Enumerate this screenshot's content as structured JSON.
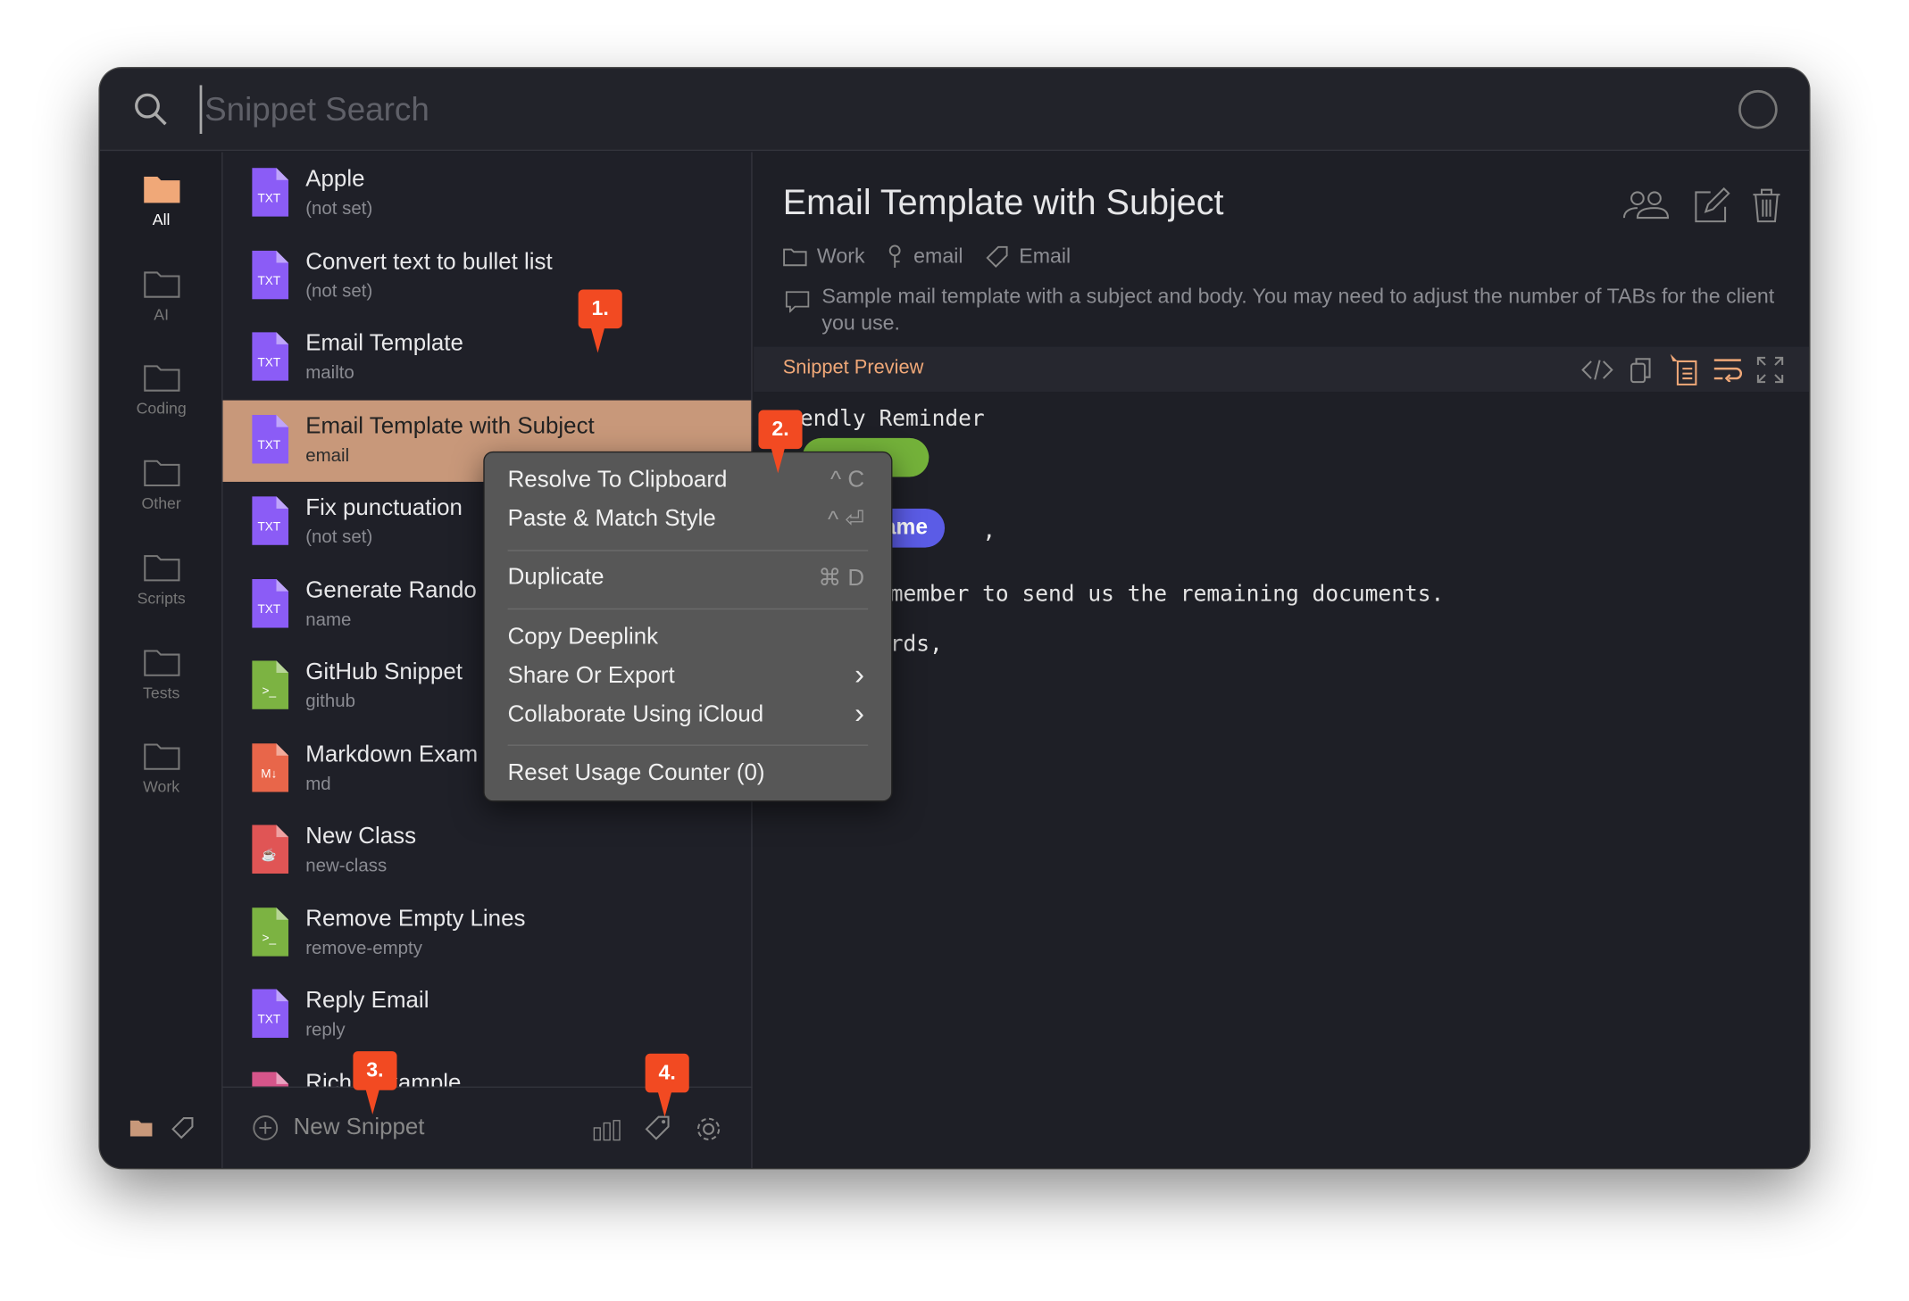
{
  "search": {
    "placeholder": "Snippet Search"
  },
  "sidebar": {
    "folders": [
      {
        "label": "All",
        "active": true
      },
      {
        "label": "AI"
      },
      {
        "label": "Coding"
      },
      {
        "label": "Other"
      },
      {
        "label": "Scripts"
      },
      {
        "label": "Tests"
      },
      {
        "label": "Work"
      }
    ]
  },
  "snippets": [
    {
      "title": "Apple",
      "subtitle": "(not set)",
      "type": "txt"
    },
    {
      "title": "Convert text to bullet list",
      "subtitle": "(not set)",
      "type": "txt"
    },
    {
      "title": "Email Template",
      "subtitle": "mailto",
      "type": "txt"
    },
    {
      "title": "Email Template with Subject",
      "subtitle": "email",
      "type": "txt",
      "selected": true
    },
    {
      "title": "Fix punctuation",
      "subtitle": "(not set)",
      "type": "txt"
    },
    {
      "title": "Generate Rando",
      "subtitle": "name",
      "type": "txt"
    },
    {
      "title": "GitHub Snippet",
      "subtitle": "github",
      "type": "shell"
    },
    {
      "title": "Markdown Exam",
      "subtitle": "md",
      "type": "md"
    },
    {
      "title": "New Class",
      "subtitle": "new-class",
      "type": "java"
    },
    {
      "title": "Remove Empty Lines",
      "subtitle": "remove-empty",
      "type": "shell"
    },
    {
      "title": "Reply Email",
      "subtitle": "reply",
      "type": "txt"
    },
    {
      "title": "Rich     t Example",
      "subtitle": "",
      "type": "rich"
    }
  ],
  "bottom": {
    "new_snippet": "New Snippet"
  },
  "detail": {
    "title": "Email Template with Subject",
    "folder": "Work",
    "keyword": "email",
    "tag": "Email",
    "description": "Sample mail template with a subject and body. You may need to adjust the number of TABs for the client you use.",
    "preview_label": "Snippet Preview",
    "preview": {
      "line1": "endly Reminder",
      "pill_name": "Name",
      "comma": ",",
      "line3": "member to send us the remaining documents.",
      "line4": "rds,"
    }
  },
  "context_menu": {
    "items": [
      {
        "label": "Resolve To Clipboard",
        "shortcut": "^ C"
      },
      {
        "label": "Paste & Match Style",
        "shortcut": "^ ⏎"
      },
      {
        "label": "Duplicate",
        "shortcut": "⌘ D"
      },
      {
        "label": "Copy Deeplink"
      },
      {
        "label": "Share Or Export",
        "shortcut": "›"
      },
      {
        "label": "Collaborate Using iCloud",
        "shortcut": "›"
      },
      {
        "label": "Reset Usage Counter (0)"
      }
    ]
  },
  "annotations": [
    "1.",
    "2.",
    "3.",
    "4."
  ],
  "colors": {
    "accent": "#c8987a",
    "preview_label": "#f0a878",
    "badge": "#f24a22",
    "pill_green": "#74b23a",
    "pill_purple": "#5b5ce6"
  }
}
